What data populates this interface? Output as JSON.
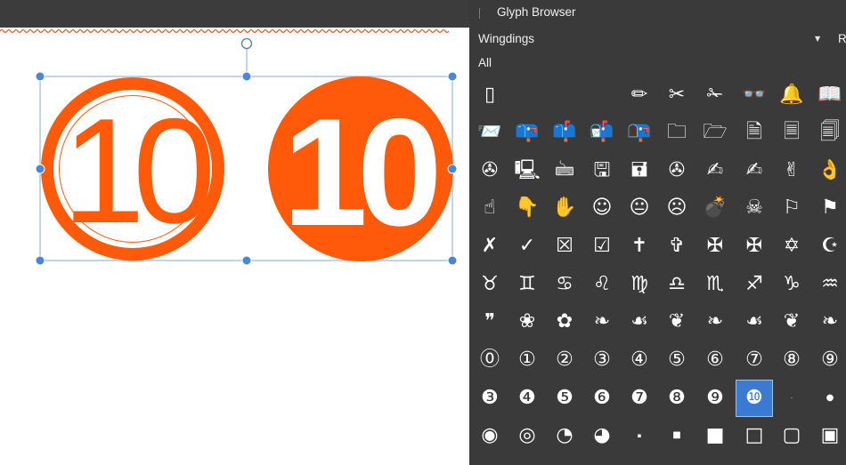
{
  "panel": {
    "title": "Glyph Browser",
    "font": "Wingdings",
    "font_side_label": "R",
    "filter": "All"
  },
  "canvas": {
    "shapes": [
      {
        "text": "10",
        "style": "outlined-circle"
      },
      {
        "text": "10",
        "style": "filled-circle"
      }
    ],
    "accent": "#ff5a0a",
    "selection_color": "#4a86d8"
  },
  "glyph_rows": [
    [
      {
        "name": "candle-icon",
        "ch": "▯"
      },
      {
        "name": "empty-glyph",
        "ch": ""
      },
      {
        "name": "empty-glyph",
        "ch": ""
      },
      {
        "name": "empty-glyph",
        "ch": ""
      },
      {
        "name": "pencil-icon",
        "ch": "✏"
      },
      {
        "name": "scissors-icon",
        "ch": "✂"
      },
      {
        "name": "scissors-cutting-icon",
        "ch": "✁"
      },
      {
        "name": "glasses-icon",
        "ch": "👓"
      },
      {
        "name": "bell-icon",
        "ch": "🔔"
      },
      {
        "name": "open-book-icon",
        "ch": "📖"
      }
    ],
    [
      {
        "name": "envelope-icon",
        "ch": "📨"
      },
      {
        "name": "mailbox-closed-icon",
        "ch": "📪"
      },
      {
        "name": "mailbox-flag-up-icon",
        "ch": "📫"
      },
      {
        "name": "mailbox-open-flag-icon",
        "ch": "📬"
      },
      {
        "name": "mailbox-open-icon",
        "ch": "📭"
      },
      {
        "name": "folder-icon",
        "ch": "🗀"
      },
      {
        "name": "open-folder-icon",
        "ch": "🗁"
      },
      {
        "name": "document-icon",
        "ch": "🗎"
      },
      {
        "name": "page-icon",
        "ch": "🗏"
      },
      {
        "name": "pages-icon",
        "ch": "🗐"
      }
    ],
    [
      {
        "name": "tape-icon",
        "ch": "✇"
      },
      {
        "name": "computer-icon",
        "ch": "🖳"
      },
      {
        "name": "keyboard-icon",
        "ch": "🖮"
      },
      {
        "name": "floppy-icon",
        "ch": "🖫"
      },
      {
        "name": "floppy-disk-icon",
        "ch": "🖬"
      },
      {
        "name": "disc-icon",
        "ch": "✇"
      },
      {
        "name": "writing-hand-icon",
        "ch": "✍"
      },
      {
        "name": "writing-left-hand-icon",
        "ch": "✍"
      },
      {
        "name": "victory-hand-icon",
        "ch": "✌"
      },
      {
        "name": "ok-hand-icon",
        "ch": "👌"
      }
    ],
    [
      {
        "name": "pointing-up-icon",
        "ch": "☝"
      },
      {
        "name": "pointing-down-icon",
        "ch": "👇"
      },
      {
        "name": "raised-hand-icon",
        "ch": "✋"
      },
      {
        "name": "smiley-icon",
        "ch": "☺"
      },
      {
        "name": "neutral-face-icon",
        "ch": "😐"
      },
      {
        "name": "frown-icon",
        "ch": "☹"
      },
      {
        "name": "bomb-icon",
        "ch": "💣"
      },
      {
        "name": "skull-icon",
        "ch": "☠"
      },
      {
        "name": "flag-icon",
        "ch": "⚐"
      },
      {
        "name": "pennant-icon",
        "ch": "⚑"
      }
    ],
    [
      {
        "name": "ballot-x-icon",
        "ch": "✗"
      },
      {
        "name": "check-icon",
        "ch": "✓"
      },
      {
        "name": "ballot-box-x-icon",
        "ch": "☒"
      },
      {
        "name": "ballot-box-check-icon",
        "ch": "☑"
      },
      {
        "name": "latin-cross-icon",
        "ch": "✝"
      },
      {
        "name": "shadowed-cross-icon",
        "ch": "✞"
      },
      {
        "name": "celtic-cross-icon",
        "ch": "✠"
      },
      {
        "name": "maltese-cross-icon",
        "ch": "✠"
      },
      {
        "name": "star-of-david-icon",
        "ch": "✡"
      },
      {
        "name": "crescent-star-icon",
        "ch": "☪"
      }
    ],
    [
      {
        "name": "taurus-icon",
        "ch": "♉"
      },
      {
        "name": "gemini-icon",
        "ch": "♊"
      },
      {
        "name": "cancer-icon",
        "ch": "♋"
      },
      {
        "name": "leo-icon",
        "ch": "♌"
      },
      {
        "name": "virgo-icon",
        "ch": "♍"
      },
      {
        "name": "libra-icon",
        "ch": "♎"
      },
      {
        "name": "scorpio-icon",
        "ch": "♏"
      },
      {
        "name": "sagittarius-icon",
        "ch": "♐"
      },
      {
        "name": "capricorn-icon",
        "ch": "♑"
      },
      {
        "name": "aquarius-icon",
        "ch": "♒"
      }
    ],
    [
      {
        "name": "quote-icon",
        "ch": "❞"
      },
      {
        "name": "flower-outline-icon",
        "ch": "❀"
      },
      {
        "name": "flower-solid-icon",
        "ch": "✿"
      },
      {
        "name": "ornament-1-icon",
        "ch": "❧"
      },
      {
        "name": "ornament-2-icon",
        "ch": "☙"
      },
      {
        "name": "ornament-3-icon",
        "ch": "❦"
      },
      {
        "name": "ornament-4-icon",
        "ch": "❧"
      },
      {
        "name": "ornament-5-icon",
        "ch": "☙"
      },
      {
        "name": "ornament-6-icon",
        "ch": "❦"
      },
      {
        "name": "ornament-7-icon",
        "ch": "❧"
      }
    ],
    [
      {
        "name": "circled-0-icon",
        "ch": "⓪"
      },
      {
        "name": "circled-1-icon",
        "ch": "①"
      },
      {
        "name": "circled-2-icon",
        "ch": "②"
      },
      {
        "name": "circled-3-icon",
        "ch": "③"
      },
      {
        "name": "circled-4-icon",
        "ch": "④"
      },
      {
        "name": "circled-5-icon",
        "ch": "⑤"
      },
      {
        "name": "circled-6-icon",
        "ch": "⑥"
      },
      {
        "name": "circled-7-icon",
        "ch": "⑦"
      },
      {
        "name": "circled-8-icon",
        "ch": "⑧"
      },
      {
        "name": "circled-9-icon",
        "ch": "⑨"
      }
    ],
    [
      {
        "name": "negative-circled-3-icon",
        "ch": "❸"
      },
      {
        "name": "negative-circled-4-icon",
        "ch": "❹"
      },
      {
        "name": "negative-circled-5-icon",
        "ch": "❺"
      },
      {
        "name": "negative-circled-6-icon",
        "ch": "❻"
      },
      {
        "name": "negative-circled-7-icon",
        "ch": "❼"
      },
      {
        "name": "negative-circled-8-icon",
        "ch": "❽"
      },
      {
        "name": "negative-circled-9-icon",
        "ch": "❾"
      },
      {
        "name": "negative-circled-10-icon",
        "ch": "❿",
        "selected": true
      },
      {
        "name": "middle-dot-icon",
        "ch": "·",
        "size": "tiny"
      },
      {
        "name": "bullet-icon",
        "ch": "●",
        "size": "small"
      }
    ],
    [
      {
        "name": "bullseye-icon",
        "ch": "◉"
      },
      {
        "name": "target-icon",
        "ch": "◎"
      },
      {
        "name": "circle-shadow-icon",
        "ch": "◔"
      },
      {
        "name": "circle-shadow-2-icon",
        "ch": "◕"
      },
      {
        "name": "small-square-icon",
        "ch": "▪",
        "size": "tiny"
      },
      {
        "name": "square-icon",
        "ch": "■",
        "size": "small"
      },
      {
        "name": "large-square-icon",
        "ch": "■"
      },
      {
        "name": "hollow-square-icon",
        "ch": "□"
      },
      {
        "name": "bold-square-icon",
        "ch": "▢"
      },
      {
        "name": "heavy-square-icon",
        "ch": "▣"
      }
    ]
  ]
}
